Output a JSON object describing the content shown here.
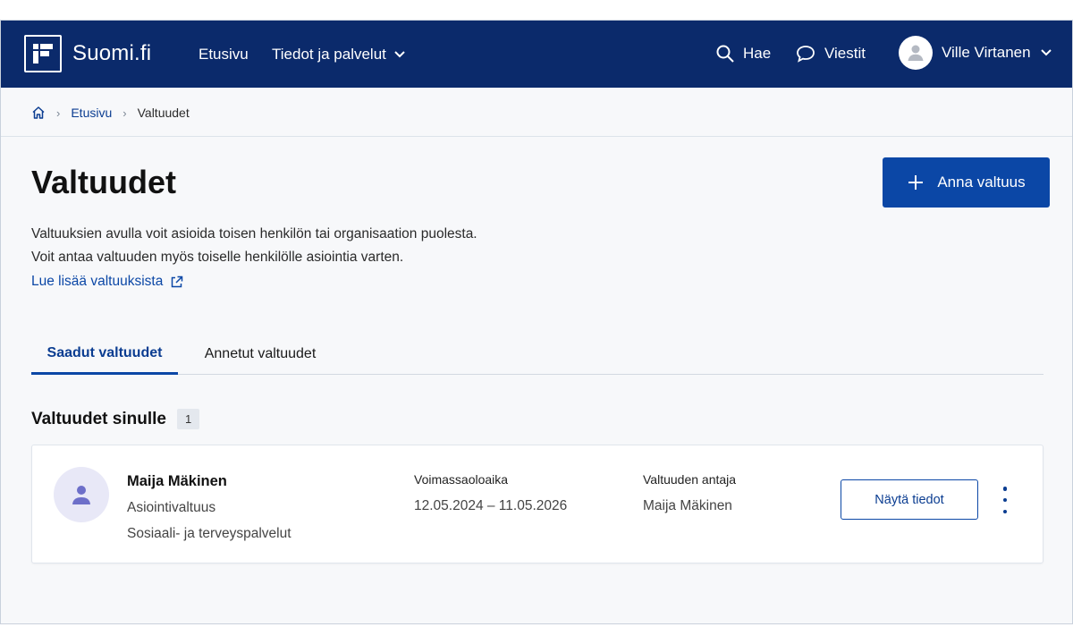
{
  "header": {
    "logo_text": "Suomi.fi",
    "nav": [
      {
        "label": "Etusivu"
      },
      {
        "label": "Tiedot ja palvelut"
      }
    ],
    "search_label": "Hae",
    "messages_label": "Viestit",
    "user_name": "Ville Virtanen"
  },
  "breadcrumb": {
    "home_icon": "home-icon",
    "items": [
      {
        "label": "Etusivu"
      },
      {
        "label": "Valtuudet"
      }
    ]
  },
  "page": {
    "title": "Valtuudet",
    "add_button_label": "Anna valtuus",
    "description_line1": "Valtuuksien avulla voit asioida toisen henkilön tai organisaation puolesta.",
    "description_line2": "Voit antaa valtuuden myös toiselle henkilölle asiointia varten.",
    "learn_more_link": "Lue lisää valtuuksista"
  },
  "tabs": [
    {
      "label": "Saadut valtuudet",
      "active": true
    },
    {
      "label": "Annetut valtuudet",
      "active": false
    }
  ],
  "section": {
    "title": "Valtuudet sinulle",
    "count": "1"
  },
  "mandates": [
    {
      "name": "Maija Mäkinen",
      "type": "Asiointivaltuus",
      "scope": "Sosiaali- ja terveyspalvelut",
      "validity_label": "Voimassaoloaika",
      "validity_value": "12.05.2024 – 11.05.2026",
      "grantor_label": "Valtuuden antaja",
      "grantor_value": "Maija Mäkinen",
      "details_button_label": "Näytä tiedot"
    }
  ],
  "colors": {
    "header_bg": "#0b2a6b",
    "primary": "#0b47a6",
    "link": "#0b3d91",
    "page_bg": "#f7f8fa"
  }
}
